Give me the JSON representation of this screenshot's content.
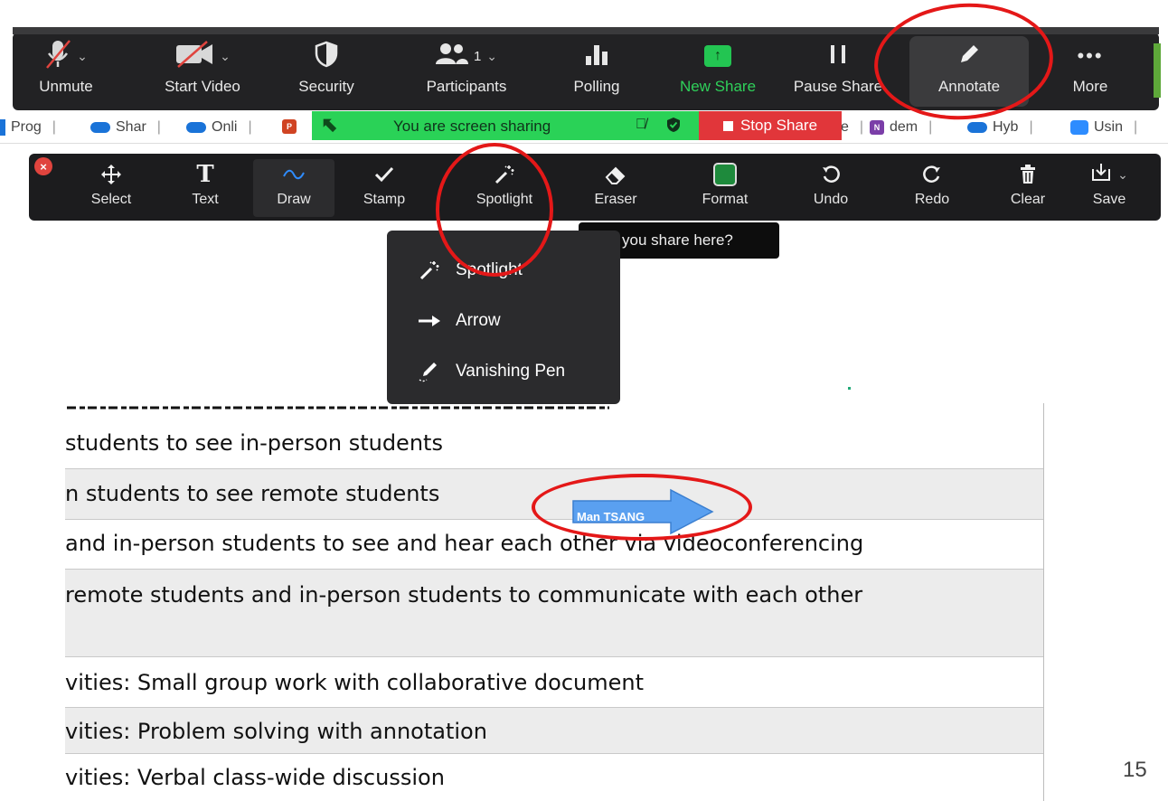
{
  "meeting_toolbar": {
    "items": [
      {
        "label": "Unmute",
        "icon": "muted-mic-icon"
      },
      {
        "label": "Start Video",
        "icon": "video-off-icon"
      },
      {
        "label": "Security",
        "icon": "shield-icon"
      },
      {
        "label": "Participants",
        "icon": "participants-icon",
        "count": "1"
      },
      {
        "label": "Polling",
        "icon": "poll-chart-icon"
      },
      {
        "label": "New Share",
        "icon": "share-arrow-icon"
      },
      {
        "label": "Pause Share",
        "icon": "pause-icon"
      },
      {
        "label": "Annotate",
        "icon": "pencil-icon"
      },
      {
        "label": "More",
        "icon": "ellipsis-icon"
      }
    ]
  },
  "taskbar_tabs": [
    "Prog",
    "Shar",
    "Onli",
    "e",
    "dem",
    "Hyb",
    "Usin"
  ],
  "share_banner": {
    "text": "You are screen sharing",
    "stop_label": "Stop Share"
  },
  "annotation_toolbar": {
    "items": [
      {
        "label": "Select",
        "icon": "move-arrows-icon"
      },
      {
        "label": "Text",
        "icon": "text-t-icon"
      },
      {
        "label": "Draw",
        "icon": "squiggle-icon"
      },
      {
        "label": "Stamp",
        "icon": "checkmark-icon"
      },
      {
        "label": "Spotlight",
        "icon": "magic-wand-icon"
      },
      {
        "label": "Eraser",
        "icon": "eraser-icon"
      },
      {
        "label": "Format",
        "icon": "format-square-icon"
      },
      {
        "label": "Undo",
        "icon": "undo-icon"
      },
      {
        "label": "Redo",
        "icon": "redo-icon"
      },
      {
        "label": "Clear",
        "icon": "trash-icon"
      },
      {
        "label": "Save",
        "icon": "save-download-icon"
      }
    ]
  },
  "tooltip": "you share here?",
  "spotlight_menu": {
    "items": [
      {
        "label": "Spotlight",
        "icon": "magic-wand-icon"
      },
      {
        "label": "Arrow",
        "icon": "arrow-right-icon"
      },
      {
        "label": "Vanishing Pen",
        "icon": "vanishing-pen-icon"
      }
    ]
  },
  "arrow_annotation": {
    "label": "Man TSANG"
  },
  "slide": {
    "rows": [
      "students to see in-person students",
      "n students to see remote students",
      "and in-person students to see and hear each other via videoconferencing",
      " remote students and in-person students to communicate with each other",
      "vities: Small group work with collaborative document",
      "vities: Problem solving with annotation",
      "vities: Verbal class-wide discussion"
    ],
    "page_number": "15"
  },
  "colors": {
    "toolbar_bg": "#222224",
    "share_green": "#2ad257",
    "stop_red": "#e1363a",
    "annotation_ring": "#e41818",
    "arrow_blue": "#5aa0f0"
  }
}
